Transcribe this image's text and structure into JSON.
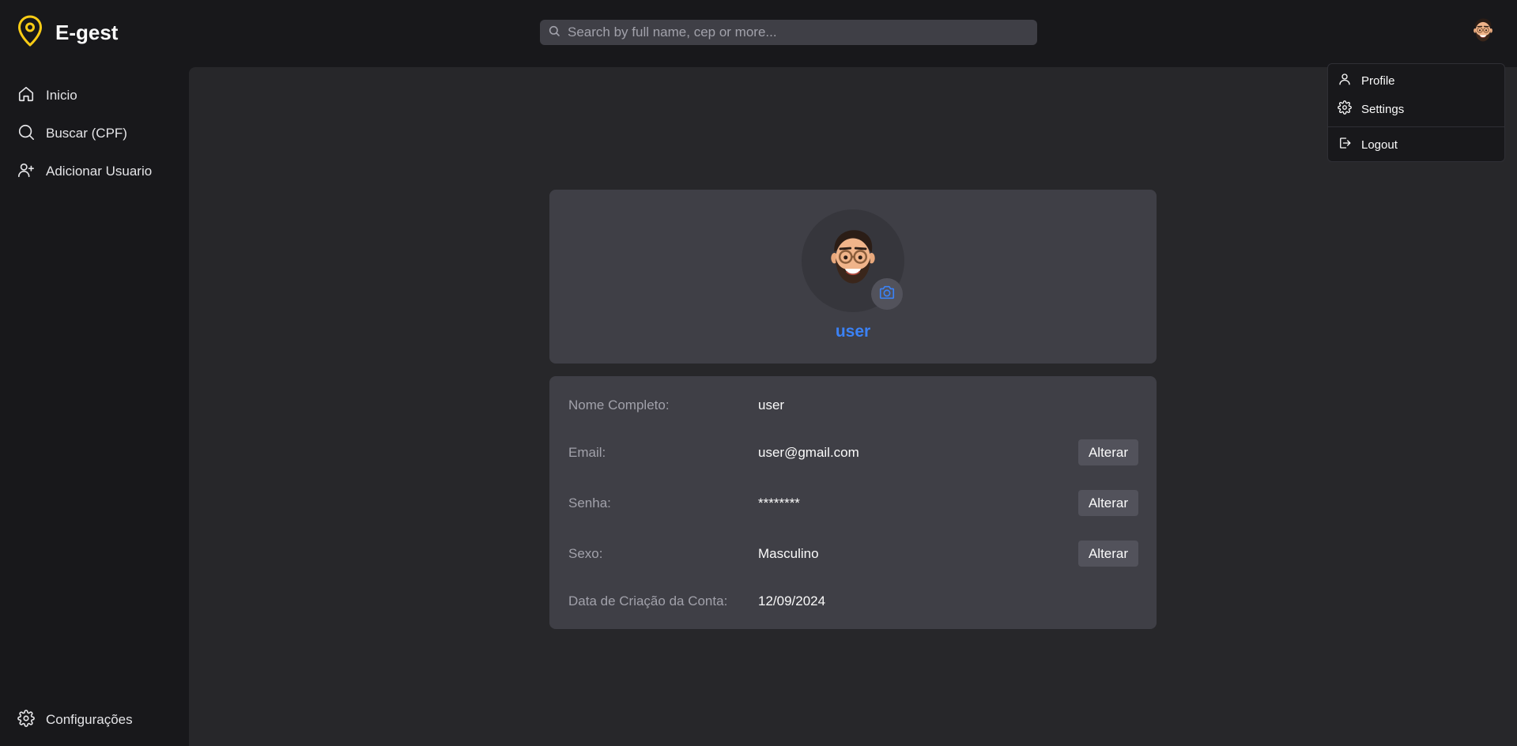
{
  "app": {
    "name": "E-gest",
    "brand_color": "#facc15",
    "logo_icon": "map-pin-icon"
  },
  "search": {
    "placeholder": "Search by full name, cep or more...",
    "icon": "search-icon"
  },
  "sidebar": {
    "items": [
      {
        "label": "Inicio",
        "icon": "home-icon"
      },
      {
        "label": "Buscar (CPF)",
        "icon": "search-icon"
      },
      {
        "label": "Adicionar Usuario",
        "icon": "user-plus-icon"
      }
    ],
    "footer_item": {
      "label": "Configurações",
      "icon": "gear-icon"
    }
  },
  "user_menu": {
    "items": [
      {
        "label": "Profile",
        "icon": "user-icon"
      },
      {
        "label": "Settings",
        "icon": "gear-icon"
      }
    ],
    "logout_label": "Logout",
    "logout_icon": "logout-icon"
  },
  "profile": {
    "name": "user",
    "name_color": "#3b82f6",
    "avatar_icon": "memoji-avatar",
    "camera_icon": "camera-icon"
  },
  "details": {
    "change_label": "Alterar",
    "rows": [
      {
        "label": "Nome Completo:",
        "value": "user"
      },
      {
        "label": "Email:",
        "value": "user@gmail.com"
      },
      {
        "label": "Senha:",
        "value": "********"
      },
      {
        "label": "Sexo:",
        "value": "Masculino"
      },
      {
        "label": "Data de Criação da Conta:",
        "value": "12/09/2024"
      }
    ]
  }
}
